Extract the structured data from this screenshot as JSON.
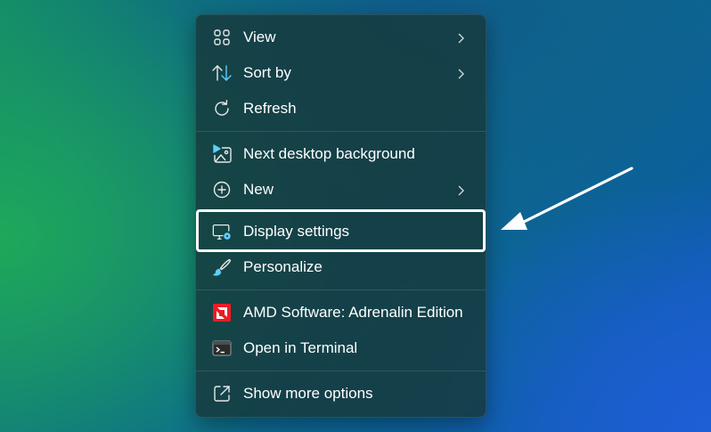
{
  "menu": {
    "items": [
      {
        "label": "View",
        "icon": "grid-view-icon",
        "submenu": true
      },
      {
        "label": "Sort by",
        "icon": "sort-arrows-icon",
        "submenu": true
      },
      {
        "label": "Refresh",
        "icon": "refresh-icon",
        "submenu": false
      },
      {
        "label": "Next desktop background",
        "icon": "next-background-icon",
        "submenu": false
      },
      {
        "label": "New",
        "icon": "plus-circle-icon",
        "submenu": true
      },
      {
        "label": "Display settings",
        "icon": "display-settings-icon",
        "submenu": false,
        "highlighted": true
      },
      {
        "label": "Personalize",
        "icon": "brush-icon",
        "submenu": false
      },
      {
        "label": "AMD Software: Adrenalin Edition",
        "icon": "amd-logo-icon",
        "submenu": false
      },
      {
        "label": "Open in Terminal",
        "icon": "terminal-icon",
        "submenu": false
      },
      {
        "label": "Show more options",
        "icon": "expand-icon",
        "submenu": false
      }
    ]
  },
  "colors": {
    "menu_bg": "#163a3e",
    "text": "#ffffff",
    "accent": "#60cdff",
    "amd_red": "#ed1c24",
    "highlight_border": "#ffffff"
  }
}
